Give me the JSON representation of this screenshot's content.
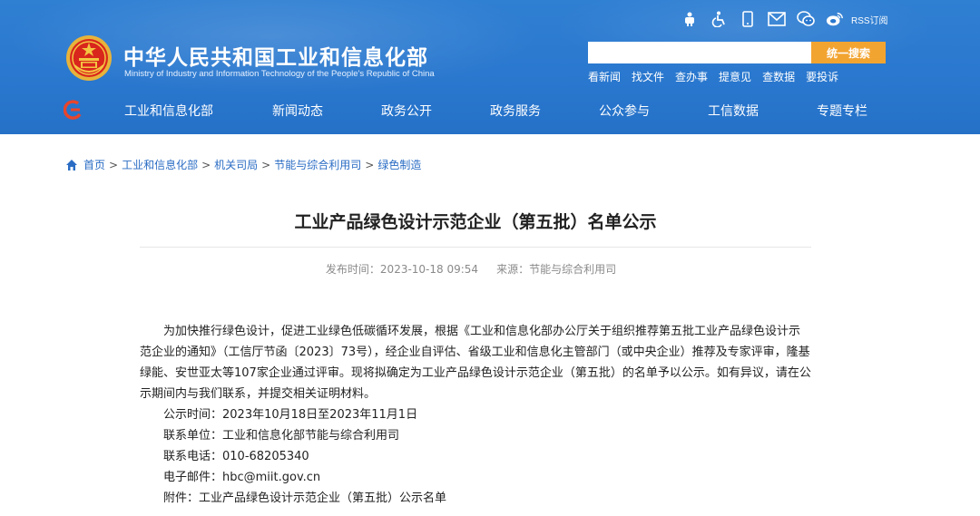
{
  "site": {
    "title_cn": "中华人民共和国工业和信息化部",
    "title_en": "Ministry of Industry and Information Technology of the People's Republic of China"
  },
  "top_icons": [
    "robot-icon",
    "accessibility-icon",
    "mobile-icon",
    "mail-icon",
    "wechat-icon",
    "weibo-icon"
  ],
  "rss_label": "RSS订阅",
  "search": {
    "placeholder": "",
    "button_label": "统一搜索"
  },
  "quick_links": [
    "看新闻",
    "找文件",
    "查办事",
    "提意见",
    "查数据",
    "要投诉"
  ],
  "nav": {
    "items": [
      "工业和信息化部",
      "新闻动态",
      "政务公开",
      "政务服务",
      "公众参与",
      "工信数据",
      "专题专栏"
    ]
  },
  "breadcrumb": [
    "首页",
    "工业和信息化部",
    "机关司局",
    "节能与综合利用司",
    "绿色制造"
  ],
  "article": {
    "title": "工业产品绿色设计示范企业（第五批）名单公示",
    "publish_time": "发布时间：2023-10-18 09:54",
    "source": "来源：节能与综合利用司",
    "body": "为加快推行绿色设计，促进工业绿色低碳循环发展，根据《工业和信息化部办公厅关于组织推荐第五批工业产品绿色设计示范企业的通知》（工信厅节函〔2023〕73号），经企业自评估、省级工业和信息化主管部门（或中央企业）推荐及专家评审，隆基绿能、安世亚太等107家企业通过评审。现将拟确定为工业产品绿色设计示范企业（第五批）的名单予以公示。如有异议，请在公示期间内与我们联系，并提交相关证明材料。",
    "lines": [
      "公示时间：2023年10月18日至2023年11月1日",
      "联系单位：工业和信息化部节能与综合利用司",
      "联系电话：010-68205340",
      "电子邮件：hbc@miit.gov.cn",
      "附件：工业产品绿色设计示范企业（第五批）公示名单"
    ]
  },
  "colors": {
    "header_blue": "#2a78cf",
    "search_button": "#f2a431",
    "link_blue": "#2a6cc4"
  }
}
